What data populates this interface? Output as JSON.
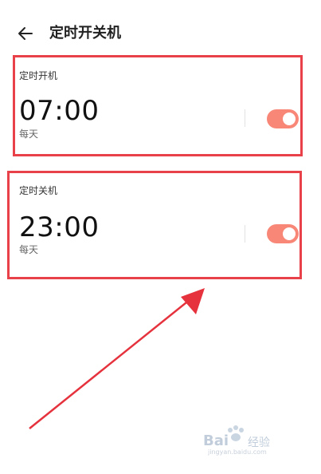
{
  "header": {
    "title": "定时开关机"
  },
  "timers": [
    {
      "label": "定时开机",
      "time": "07:00",
      "repeat": "每天",
      "enabled": true
    },
    {
      "label": "定时关机",
      "time": "23:00",
      "repeat": "每天",
      "enabled": true
    }
  ],
  "colors": {
    "toggle_on": "#f88778",
    "annotation": "#e8414a",
    "arrow": "#e5323d"
  },
  "watermark": {
    "brand": "Bai",
    "brand2": "经验",
    "url": "jingyan.baidu.com"
  }
}
